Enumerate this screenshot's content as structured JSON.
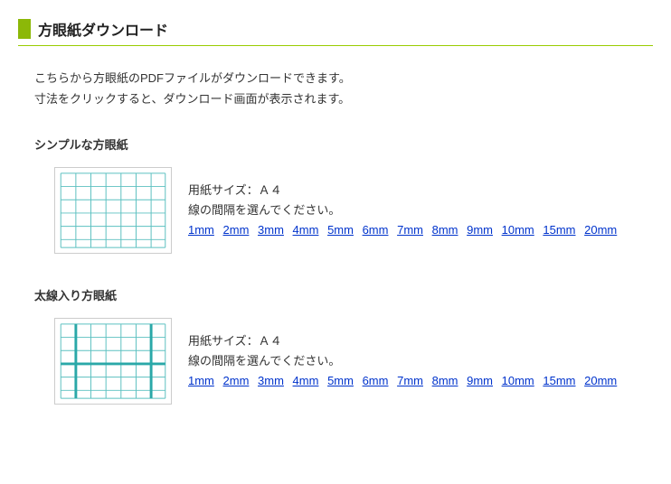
{
  "page": {
    "title": "方眼紙ダウンロード",
    "intro_line1": "こちらから方眼紙のPDFファイルがダウンロードできます。",
    "intro_line2": "寸法をクリックすると、ダウンロード画面が表示されます。"
  },
  "sections": {
    "simple": {
      "heading": "シンプルな方眼紙",
      "paper_size": "用紙サイズ：Ａ４",
      "instruction": "線の間隔を選んでください。",
      "links": [
        "1mm",
        "2mm",
        "3mm",
        "4mm",
        "5mm",
        "6mm",
        "7mm",
        "8mm",
        "9mm",
        "10mm",
        "15mm",
        "20mm"
      ]
    },
    "bold": {
      "heading": "太線入り方眼紙",
      "paper_size": "用紙サイズ：Ａ４",
      "instruction": "線の間隔を選んでください。",
      "links": [
        "1mm",
        "2mm",
        "3mm",
        "4mm",
        "5mm",
        "6mm",
        "7mm",
        "8mm",
        "9mm",
        "10mm",
        "15mm",
        "20mm"
      ]
    }
  }
}
